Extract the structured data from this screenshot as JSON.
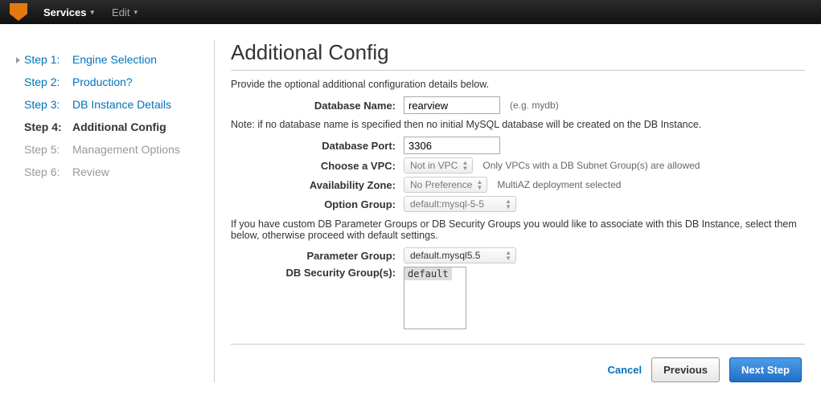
{
  "topbar": {
    "services": "Services",
    "edit": "Edit"
  },
  "steps": [
    {
      "label": "Step 1:",
      "title": "Engine Selection",
      "state": "done"
    },
    {
      "label": "Step 2:",
      "title": "Production?",
      "state": "done"
    },
    {
      "label": "Step 3:",
      "title": "DB Instance Details",
      "state": "done"
    },
    {
      "label": "Step 4:",
      "title": "Additional Config",
      "state": "active"
    },
    {
      "label": "Step 5:",
      "title": "Management Options",
      "state": "future"
    },
    {
      "label": "Step 6:",
      "title": "Review",
      "state": "future"
    }
  ],
  "main": {
    "title": "Additional Config",
    "intro": "Provide the optional additional configuration details below.",
    "dbname_label": "Database Name:",
    "dbname_value": "rearview",
    "dbname_hint": "(e.g. mydb)",
    "note1": "Note: if no database name is specified then no initial MySQL database will be created on the DB Instance.",
    "dbport_label": "Database Port:",
    "dbport_value": "3306",
    "vpc_label": "Choose a VPC:",
    "vpc_value": "Not in VPC",
    "vpc_hint": "Only VPCs with a DB Subnet Group(s) are allowed",
    "az_label": "Availability Zone:",
    "az_value": "No Preference",
    "az_hint": "MultiAZ deployment selected",
    "og_label": "Option Group:",
    "og_value": "default:mysql-5-5",
    "note2": "If you have custom DB Parameter Groups or DB Security Groups you would like to associate with this DB Instance, select them below, otherwise proceed with default settings.",
    "pg_label": "Parameter Group:",
    "pg_value": "default.mysql5.5",
    "sg_label": "DB Security Group(s):",
    "sg_option": "default"
  },
  "buttons": {
    "cancel": "Cancel",
    "previous": "Previous",
    "next": "Next Step"
  }
}
